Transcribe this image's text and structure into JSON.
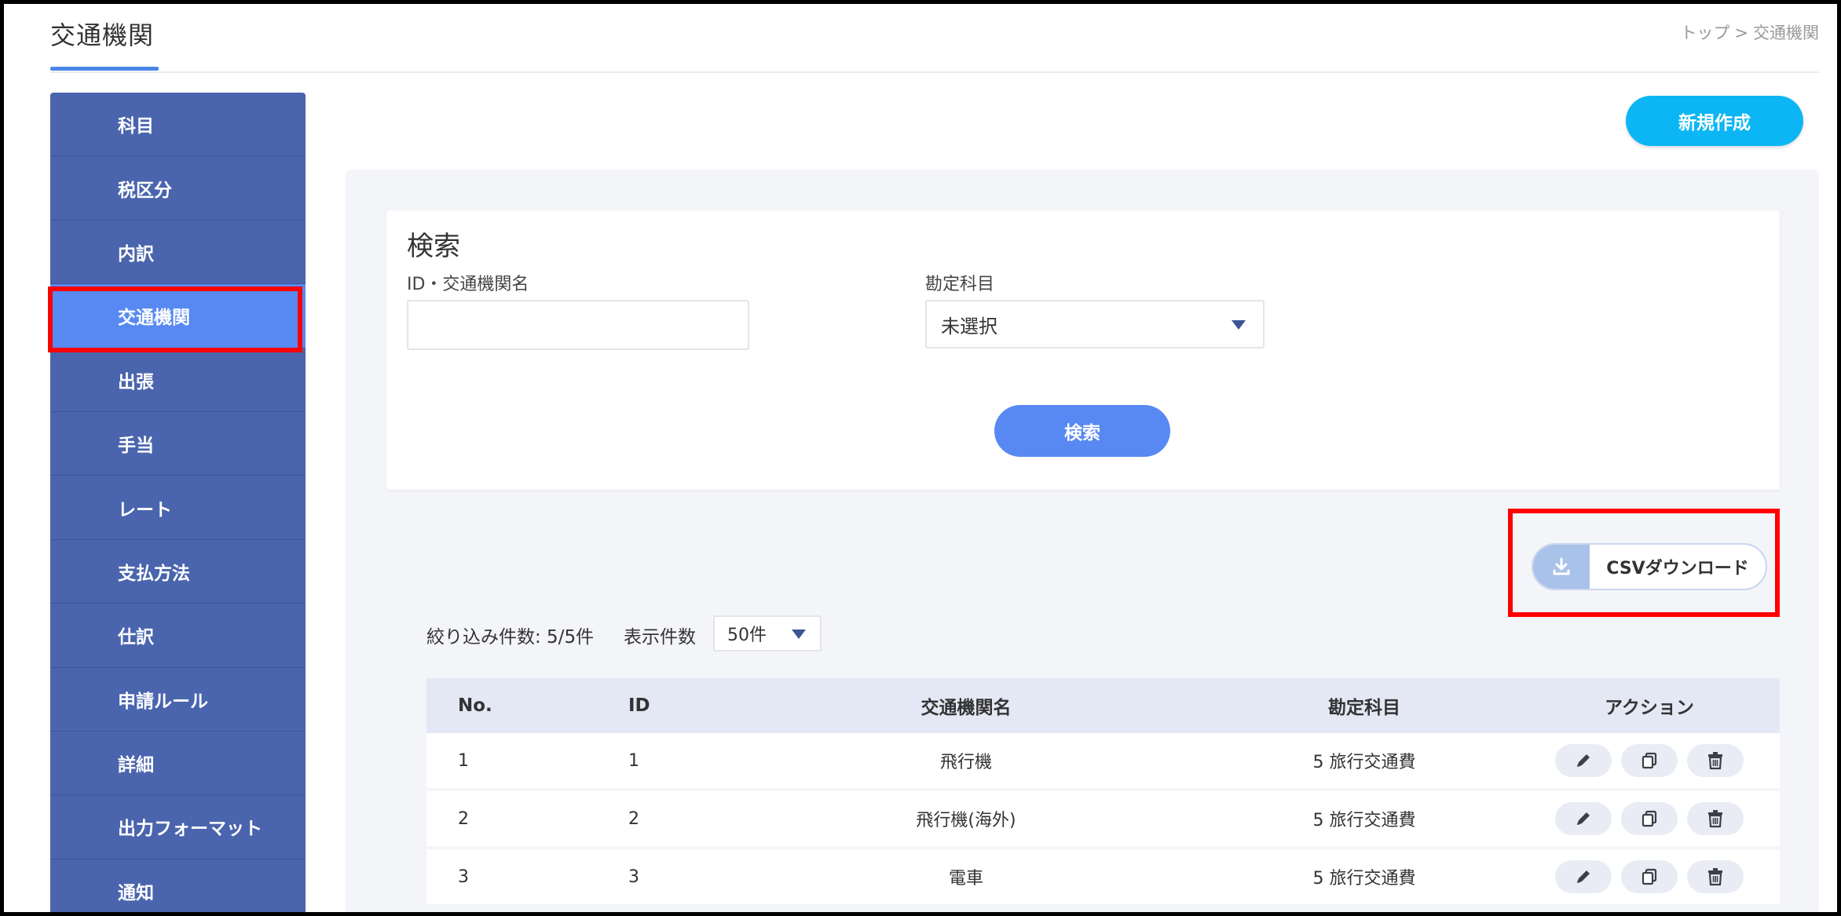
{
  "header": {
    "title": "交通機関",
    "breadcrumb": [
      "トップ",
      ">",
      "交通機関"
    ]
  },
  "sidebar": {
    "items": [
      {
        "label": "科目",
        "active": false
      },
      {
        "label": "税区分",
        "active": false
      },
      {
        "label": "内訳",
        "active": false
      },
      {
        "label": "交通機関",
        "active": true
      },
      {
        "label": "出張",
        "active": false
      },
      {
        "label": "手当",
        "active": false
      },
      {
        "label": "レート",
        "active": false
      },
      {
        "label": "支払方法",
        "active": false
      },
      {
        "label": "仕訳",
        "active": false
      },
      {
        "label": "申請ルール",
        "active": false
      },
      {
        "label": "詳細",
        "active": false
      },
      {
        "label": "出力フォーマット",
        "active": false
      },
      {
        "label": "通知",
        "active": false
      }
    ]
  },
  "toolbar": {
    "new_label": "新規作成"
  },
  "search": {
    "title": "検索",
    "id_name_label": "ID・交通機関名",
    "id_name_value": "",
    "account_label": "勘定科目",
    "account_value": "未選択",
    "submit_label": "検索"
  },
  "csv": {
    "label": "CSVダウンロード",
    "icon": "download-icon"
  },
  "list": {
    "filter_count": "絞り込み件数: 5/5件",
    "per_page_label": "表示件数",
    "per_page_value": "50件",
    "columns": [
      "No.",
      "ID",
      "交通機関名",
      "勘定科目",
      "アクション"
    ],
    "rows": [
      {
        "no": "1",
        "id": "1",
        "name": "飛行機",
        "account": "5 旅行交通費"
      },
      {
        "no": "2",
        "id": "2",
        "name": "飛行機(海外)",
        "account": "5 旅行交通費"
      },
      {
        "no": "3",
        "id": "3",
        "name": "電車",
        "account": "5 旅行交通費"
      }
    ],
    "action_icons": [
      "pencil-icon",
      "copy-icon",
      "trash-icon"
    ]
  },
  "colors": {
    "sidebar": "#4a65ad",
    "sidebar_active": "#5889f2",
    "primary": "#0cb6f4",
    "search_button": "#5889f2",
    "highlight": "#ff0000"
  }
}
